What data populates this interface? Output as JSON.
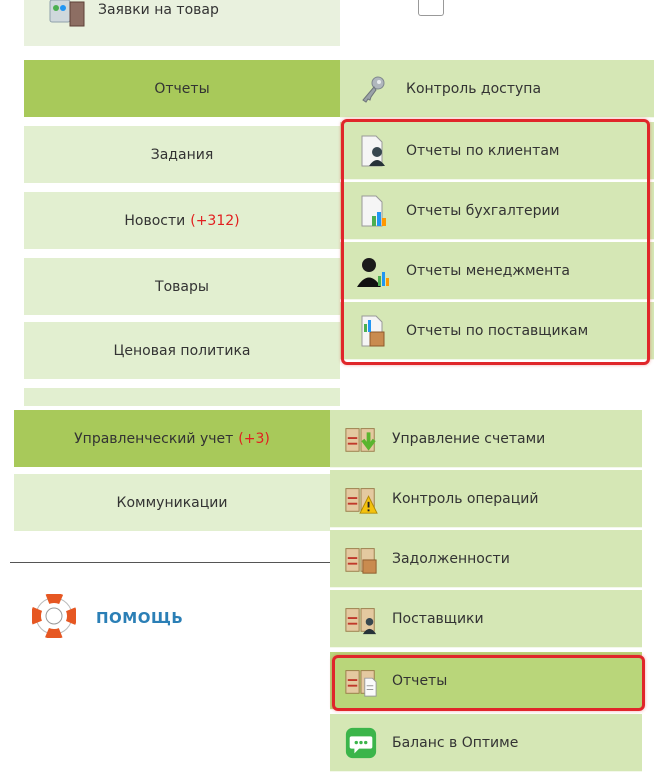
{
  "top_partial": {
    "label": "Заявки на товар",
    "icon": "orders-icon"
  },
  "main_menu": [
    {
      "label": "Отчеты",
      "badge": ""
    },
    {
      "label": "Задания",
      "badge": ""
    },
    {
      "label": "Новости",
      "badge": "(+312)"
    },
    {
      "label": "Товары",
      "badge": ""
    },
    {
      "label": "Ценовая политика",
      "badge": ""
    },
    {
      "label": "Управленческий учет",
      "badge": "(+3)"
    },
    {
      "label": "Коммуникации",
      "badge": ""
    }
  ],
  "reports_submenu": [
    {
      "label": "Контроль доступа",
      "icon": "key-icon"
    },
    {
      "label": "Отчеты по клиентам",
      "icon": "client-report-icon"
    },
    {
      "label": "Отчеты бухгалтерии",
      "icon": "accounting-report-icon"
    },
    {
      "label": "Отчеты менеджмента",
      "icon": "management-report-icon"
    },
    {
      "label": "Отчеты по поставщикам",
      "icon": "supplier-report-icon"
    }
  ],
  "accounting_submenu": [
    {
      "label": "Управление счетами",
      "icon": "accounts-management-icon"
    },
    {
      "label": "Контроль операций",
      "icon": "operations-control-icon"
    },
    {
      "label": "Задолженности",
      "icon": "debts-icon"
    },
    {
      "label": "Поставщики",
      "icon": "suppliers-icon"
    },
    {
      "label": "Отчеты",
      "icon": "reports-icon"
    },
    {
      "label": "Баланс в Оптиме",
      "icon": "chat-balance-icon"
    }
  ],
  "help": {
    "label": "ПОМОЩЬ",
    "icon": "lifebuoy-icon"
  },
  "colors": {
    "active": "#a8c95a",
    "item_bg": "#e2efd0",
    "submenu_bg": "#d5e7b5",
    "badge": "#e21f1f",
    "highlight": "#e0262a",
    "help": "#2b7fb6"
  }
}
